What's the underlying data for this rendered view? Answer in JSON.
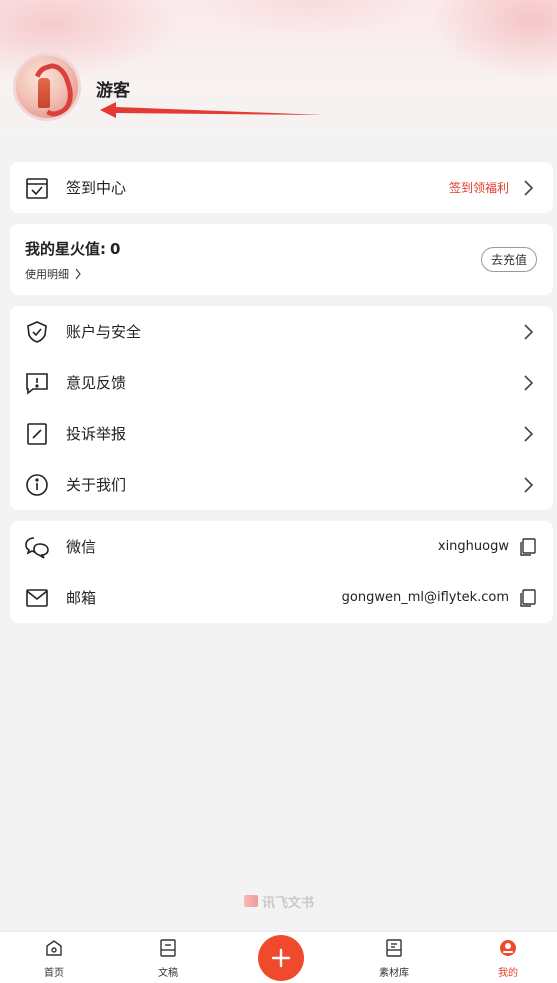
{
  "profile": {
    "username": "游客"
  },
  "checkin": {
    "label": "签到中心",
    "promo": "签到领福利",
    "promo_color": "#e03c2e"
  },
  "spark": {
    "title": "我的星火值:",
    "value": "0",
    "detail": "使用明细",
    "recharge": "去充值"
  },
  "menu": [
    {
      "label": "账户与安全",
      "icon": "shield-check-icon"
    },
    {
      "label": "意见反馈",
      "icon": "feedback-icon"
    },
    {
      "label": "投诉举报",
      "icon": "report-icon"
    },
    {
      "label": "关于我们",
      "icon": "info-icon"
    }
  ],
  "contacts": [
    {
      "label": "微信",
      "value": "xinghuogw",
      "icon": "wechat-icon"
    },
    {
      "label": "邮箱",
      "value": "gongwen_ml@iflytek.com",
      "icon": "mail-icon"
    }
  ],
  "watermark": "讯飞文书",
  "tabs": [
    {
      "label": "首页",
      "icon": "home-icon"
    },
    {
      "label": "文稿",
      "icon": "document-icon"
    },
    {
      "label": "素材库",
      "icon": "library-icon"
    },
    {
      "label": "我的",
      "icon": "profile-icon",
      "active": true
    }
  ],
  "accent_color": "#f04a2c"
}
